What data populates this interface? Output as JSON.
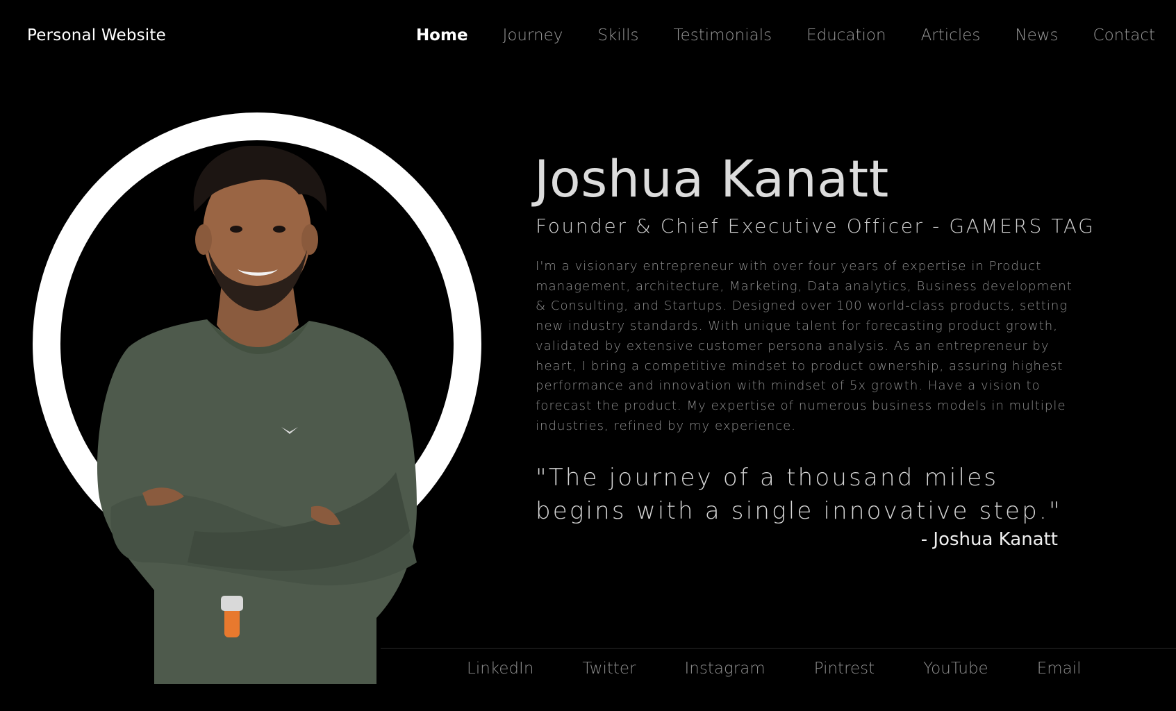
{
  "header": {
    "brand": "Personal Website",
    "nav": [
      {
        "label": "Home",
        "active": true
      },
      {
        "label": "Journey"
      },
      {
        "label": "Skills"
      },
      {
        "label": "Testimonials"
      },
      {
        "label": "Education"
      },
      {
        "label": "Articles"
      },
      {
        "label": "News"
      },
      {
        "label": "Contact"
      }
    ]
  },
  "hero": {
    "name": "Joshua Kanatt",
    "title": "Founder & Chief Executive Officer - GAMERS TAG",
    "bio": "I'm a visionary entrepreneur with over four years of expertise in Product management, architecture, Marketing, Data analytics, Business development & Consulting, and Startups. Designed over 100 world-class products, setting new industry standards. With unique talent for forecasting product growth, validated by extensive customer persona analysis. As an entrepreneur by heart, I bring a competitive mindset to product ownership, assuring highest performance and innovation with mindset of 5x growth. Have a vision to forecast the product. My expertise of numerous business models in multiple industries, refined by my experience.",
    "quote": "\"The journey of a thousand miles begins with a single innovative step.\"",
    "attribution": "- Joshua Kanatt"
  },
  "footer": {
    "social": [
      "LinkedIn",
      "Twitter",
      "Instagram",
      "Pintrest",
      "YouTube",
      "Email"
    ]
  },
  "colors": {
    "background": "#000000",
    "ring": "#ffffff",
    "sweater": "#4e5a4c",
    "watch_band": "#e8792e",
    "nav_inactive": "#9a9a9a",
    "body_text": "#8e8e8e"
  }
}
